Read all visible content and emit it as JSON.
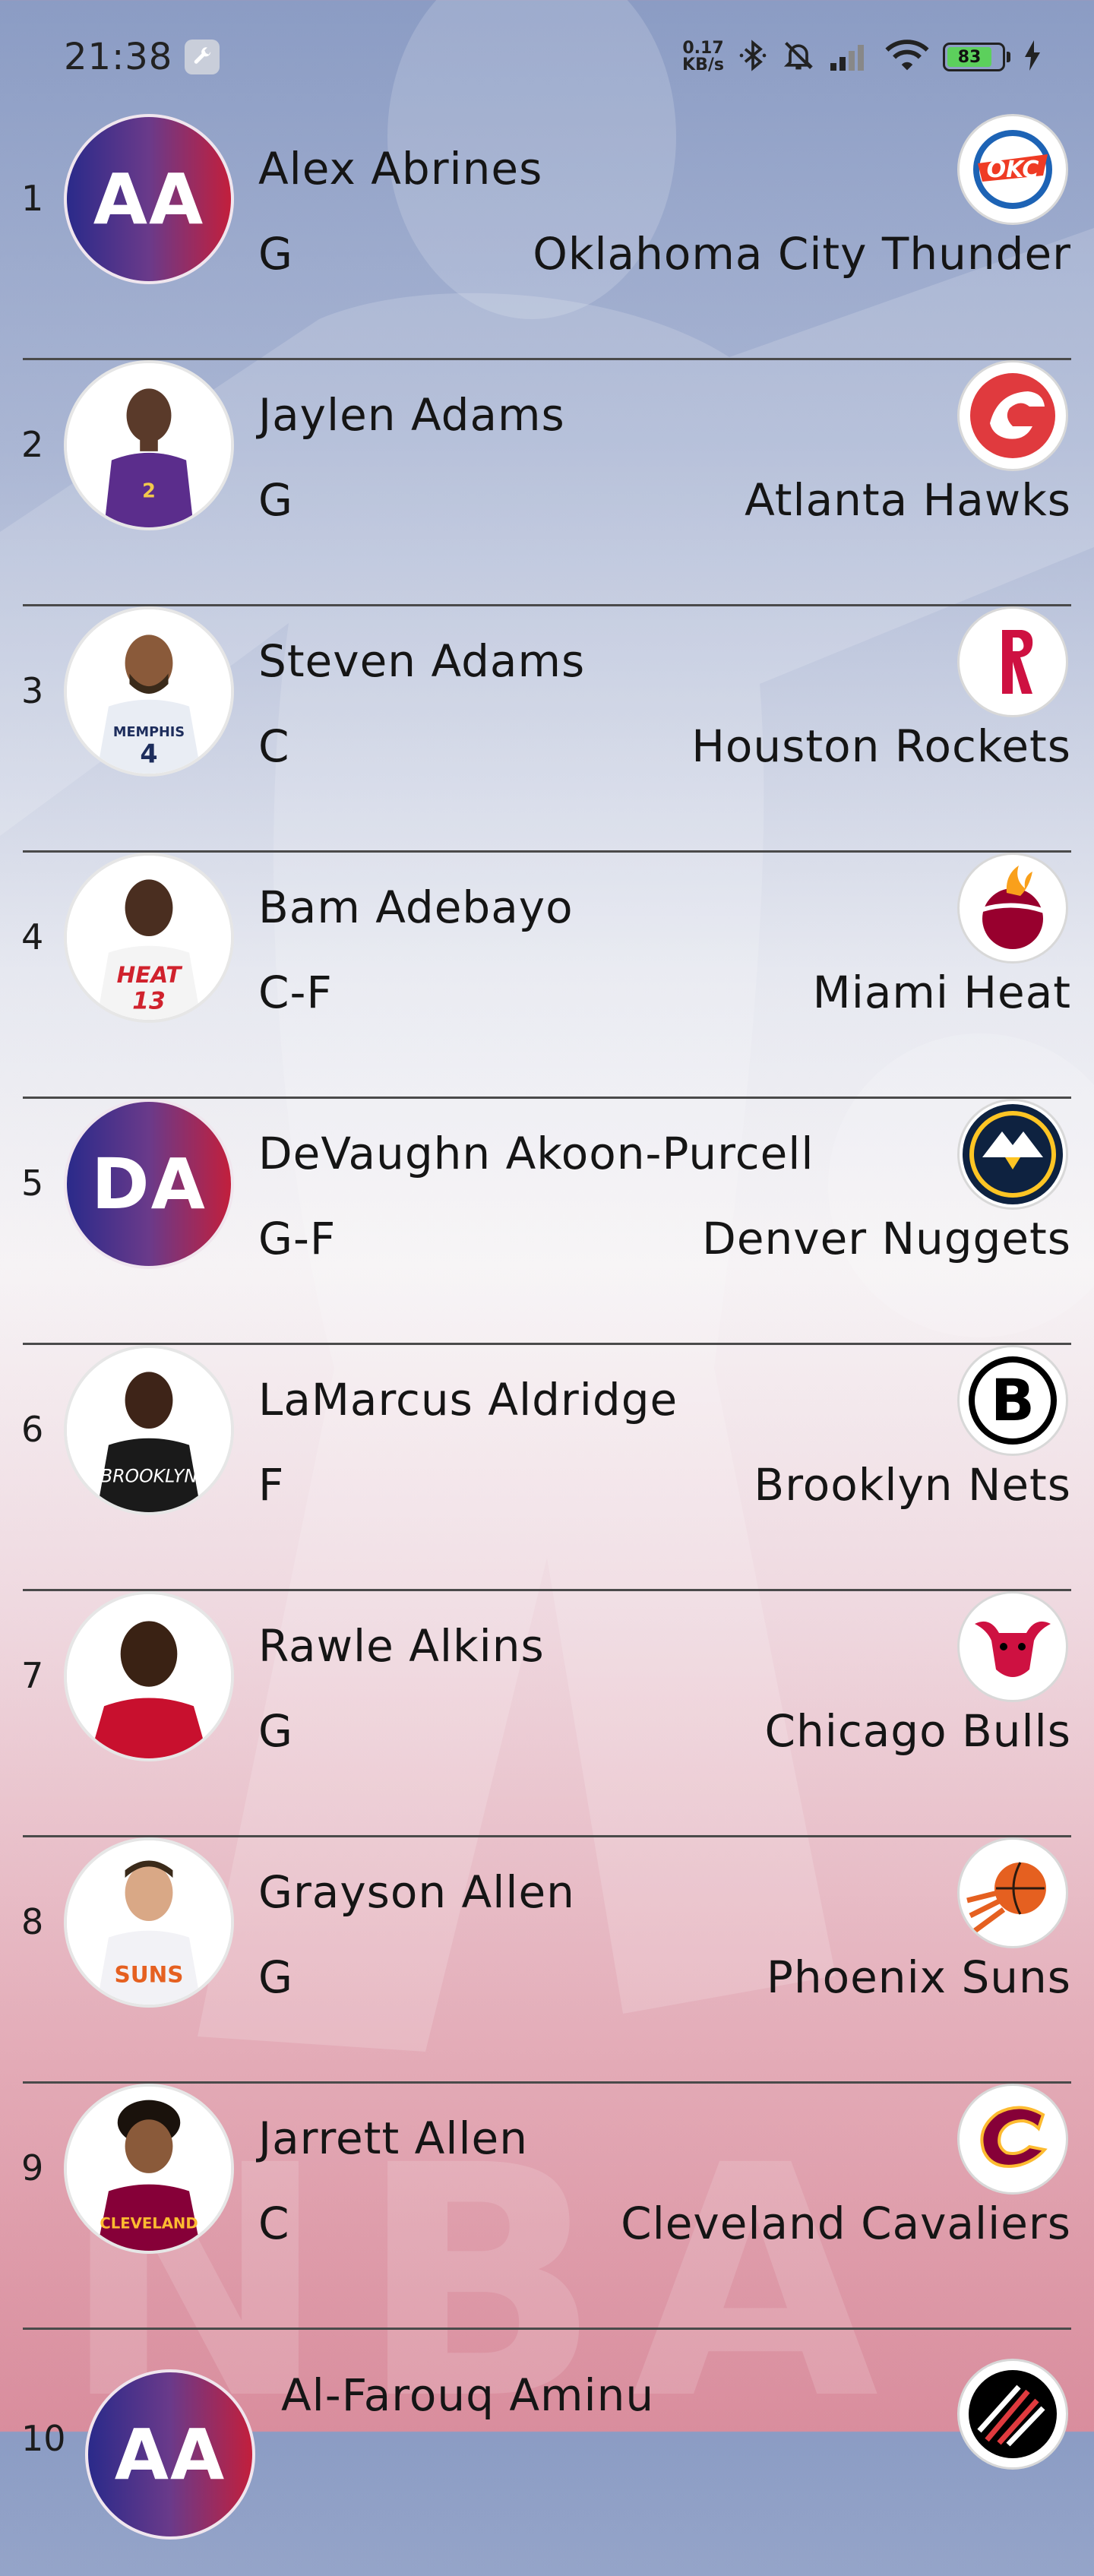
{
  "status_bar": {
    "time": "21:38",
    "net_speed_value": "0.17",
    "net_speed_unit": "KB/s",
    "battery_level": "83",
    "icons": [
      "wrench-icon",
      "bluetooth-icon",
      "mute-icon",
      "signal-icon",
      "wifi-icon",
      "battery-icon",
      "charging-icon"
    ]
  },
  "players": [
    {
      "rank": "1",
      "name": "Alex Abrines",
      "position": "G",
      "team": "Oklahoma City Thunder",
      "initials": "AA",
      "avatar_type": "initials",
      "logo": "thunder-logo-icon",
      "jersey_color": "#1d63b5"
    },
    {
      "rank": "2",
      "name": "Jaylen Adams",
      "position": "G",
      "team": "Atlanta Hawks",
      "initials": "",
      "avatar_type": "photo",
      "logo": "hawks-logo-icon",
      "jersey_color": "#5b2d8c"
    },
    {
      "rank": "3",
      "name": "Steven Adams",
      "position": "C",
      "team": "Houston Rockets",
      "initials": "",
      "avatar_type": "photo",
      "logo": "rockets-logo-icon",
      "jersey_color": "#e9edf4"
    },
    {
      "rank": "4",
      "name": "Bam Adebayo",
      "position": "C-F",
      "team": "Miami Heat",
      "initials": "",
      "avatar_type": "photo",
      "logo": "heat-logo-icon",
      "jersey_color": "#f4f4f4"
    },
    {
      "rank": "5",
      "name": "DeVaughn Akoon-Purcell",
      "position": "G-F",
      "team": "Denver Nuggets",
      "initials": "DA",
      "avatar_type": "initials",
      "logo": "nuggets-logo-icon",
      "jersey_color": "#0e2240"
    },
    {
      "rank": "6",
      "name": "LaMarcus Aldridge",
      "position": "F",
      "team": "Brooklyn Nets",
      "initials": "",
      "avatar_type": "photo",
      "logo": "nets-logo-icon",
      "jersey_color": "#1a1a1a"
    },
    {
      "rank": "7",
      "name": "Rawle Alkins",
      "position": "G",
      "team": "Chicago Bulls",
      "initials": "",
      "avatar_type": "photo",
      "logo": "bulls-logo-icon",
      "jersey_color": "#c8102e"
    },
    {
      "rank": "8",
      "name": "Grayson Allen",
      "position": "G",
      "team": "Phoenix Suns",
      "initials": "",
      "avatar_type": "photo",
      "logo": "suns-logo-icon",
      "jersey_color": "#f2f2f6"
    },
    {
      "rank": "9",
      "name": "Jarrett Allen",
      "position": "C",
      "team": "Cleveland Cavaliers",
      "initials": "",
      "avatar_type": "photo",
      "logo": "cavaliers-logo-icon",
      "jersey_color": "#860038"
    },
    {
      "rank": "10",
      "name": "Al-Farouq Aminu",
      "position": "",
      "team": "",
      "initials": "AA",
      "avatar_type": "initials",
      "logo": "trail-blazers-logo-icon",
      "jersey_color": "#c8102e"
    }
  ],
  "watermark_text": "NBA"
}
